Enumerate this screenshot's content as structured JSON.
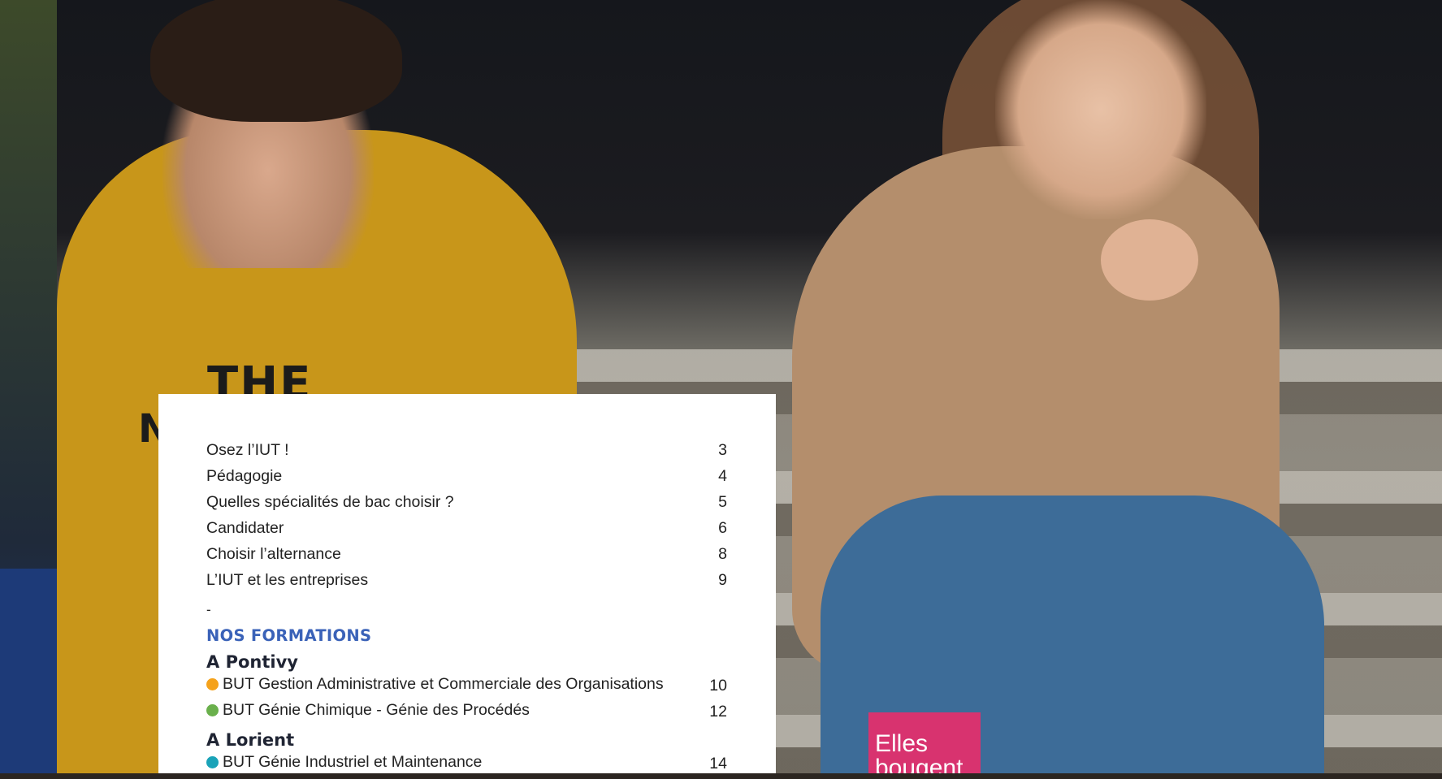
{
  "toc": {
    "entries": [
      {
        "label": "Osez l’IUT !",
        "page": "3"
      },
      {
        "label": "Pédagogie",
        "page": "4"
      },
      {
        "label": "Quelles spécialités de bac choisir ?",
        "page": "5"
      },
      {
        "label": "Candidater",
        "page": "6"
      },
      {
        "label": "Choisir l’alternance",
        "page": "8"
      },
      {
        "label": "L’IUT et les entreprises",
        "page": "9"
      }
    ],
    "separator": "-",
    "section_heading": "NOS FORMATIONS",
    "campuses": [
      {
        "name": "A Pontivy",
        "programs": [
          {
            "label": "BUT Gestion Administrative et Commerciale des Organisations",
            "page": "10",
            "color": "#f5a21b"
          },
          {
            "label": "BUT Génie Chimique - Génie des Procédés",
            "page": "12",
            "color": "#6ab04c"
          }
        ]
      },
      {
        "name": "A Lorient",
        "programs": [
          {
            "label": "BUT Génie Industriel et Maintenance",
            "page": "14",
            "color": "#1aa3b8"
          }
        ]
      }
    ]
  },
  "badge": {
    "line1": "Elles",
    "line2": "bougent"
  },
  "photo": {
    "shirt_text_1": "THE",
    "shirt_text_2": "N"
  },
  "colors": {
    "heading": "#3a62b8",
    "badge": "#d8336f"
  }
}
